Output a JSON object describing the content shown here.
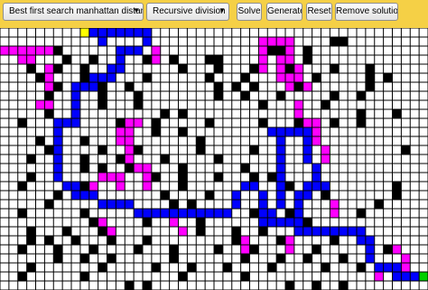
{
  "toolbar": {
    "search_select": {
      "value": "Best first search manhattan distance",
      "arrow_icon": "dropdown-arrow-icon"
    },
    "generator_select": {
      "value": "Recursive division",
      "arrow_icon": "dropdown-arrow-icon"
    },
    "solve_label": "Solve",
    "generate_label": "Generate",
    "reset_label": "Reset",
    "remove_solution_label": "Remove solution"
  },
  "maze": {
    "colors": {
      "wall": "#000000",
      "open": "#ffffff",
      "path": "#0000ff",
      "visited": "#ff00ff",
      "start": "#ffff00",
      "goal": "#00d000"
    },
    "cols": 48,
    "rows": 29,
    "grid": [
      "................................................",
      ".....................................WW.........",
      "..W..WW.......................WW..W.............",
      ".......W..W..W..W..W...WW.........W.............",
      "...W..W..W..W.......W...W...W...W....W...W......",
      "....W....W.W....W......W...W...W...W.....W.W....",
      "......W..W.W..W.........W.W.W....W.......W......",
      ".....W.....W...W........W..W...W.....W..W.......",
      "....W......W...W.............W...W..W...........",
      ".....W..W.........W.W...................W...W...",
      "..W..........W...W.....W.....W...W...W..W.......",
      ".................W..W............W..............",
      "....W....W...W........W........W...W............",
      ".....W.....W...W......W.....W..W..W..........W..",
      "...W.....W...W....W.....W...........W...........",
      "......W..W.W..W.....W......W.......W............",
      "...W.........W...W..W...W...W.W.................",
      "..W......W..........W.......W...W..W........W...",
      "......W...........W....W.......W....W.......W...",
      ".....W.............W.W....................W.....",
      "..W......W......W...W.......W...W.......W.......",
      "..........W.....W.....W...........W.............",
      "...W...W...W..........W...W..W..................",
      "...W.W..W...W...W.........W....W.....W..........",
      "..W...W...W....W...W....W...W......W.......W....",
      "......W..W..W......W.......W...W..W...W.........",
      "...W.......W.....W...W...W....W.....W...W.......",
      "..W......W..........W......W...................W",
      "..............W.W...............W..W..W........."
    ],
    "solution": [
      [
        0,
        9
      ],
      [
        0,
        10
      ],
      [
        0,
        11
      ],
      [
        0,
        12
      ],
      [
        0,
        13
      ],
      [
        0,
        14
      ],
      [
        0,
        15
      ],
      [
        0,
        16
      ],
      [
        1,
        11
      ],
      [
        1,
        16
      ],
      [
        2,
        13
      ],
      [
        2,
        14
      ],
      [
        2,
        15
      ],
      [
        3,
        13
      ],
      [
        4,
        12
      ],
      [
        4,
        13
      ],
      [
        5,
        10
      ],
      [
        5,
        11
      ],
      [
        5,
        12
      ],
      [
        6,
        8
      ],
      [
        6,
        9
      ],
      [
        6,
        10
      ],
      [
        7,
        8
      ],
      [
        8,
        8
      ],
      [
        9,
        8
      ],
      [
        10,
        6
      ],
      [
        10,
        7
      ],
      [
        10,
        8
      ],
      [
        11,
        6
      ],
      [
        12,
        6
      ],
      [
        13,
        6
      ],
      [
        14,
        6
      ],
      [
        15,
        6
      ],
      [
        16,
        6
      ],
      [
        17,
        7
      ],
      [
        17,
        8
      ],
      [
        18,
        8
      ],
      [
        18,
        9
      ],
      [
        18,
        10
      ],
      [
        19,
        11
      ],
      [
        19,
        12
      ],
      [
        19,
        13
      ],
      [
        19,
        14
      ],
      [
        20,
        15
      ],
      [
        20,
        16
      ],
      [
        20,
        17
      ],
      [
        20,
        18
      ],
      [
        20,
        19
      ],
      [
        20,
        20
      ],
      [
        20,
        21
      ],
      [
        20,
        22
      ],
      [
        20,
        23
      ],
      [
        20,
        24
      ],
      [
        20,
        25
      ],
      [
        19,
        26
      ],
      [
        18,
        26
      ],
      [
        17,
        27
      ],
      [
        17,
        28
      ],
      [
        18,
        29
      ],
      [
        19,
        29
      ],
      [
        20,
        29
      ],
      [
        21,
        29
      ],
      [
        21,
        30
      ],
      [
        21,
        31
      ],
      [
        21,
        32
      ],
      [
        20,
        30
      ],
      [
        19,
        31
      ],
      [
        18,
        31
      ],
      [
        17,
        31
      ],
      [
        16,
        31
      ],
      [
        15,
        31
      ],
      [
        14,
        31
      ],
      [
        13,
        31
      ],
      [
        12,
        31
      ],
      [
        11,
        30
      ],
      [
        11,
        31
      ],
      [
        11,
        32
      ],
      [
        11,
        33
      ],
      [
        11,
        34
      ],
      [
        12,
        34
      ],
      [
        13,
        34
      ],
      [
        14,
        34
      ],
      [
        15,
        35
      ],
      [
        16,
        35
      ],
      [
        17,
        34
      ],
      [
        17,
        35
      ],
      [
        17,
        36
      ],
      [
        18,
        33
      ],
      [
        18,
        34
      ],
      [
        19,
        33
      ],
      [
        20,
        33
      ],
      [
        21,
        33
      ],
      [
        22,
        33
      ],
      [
        22,
        34
      ],
      [
        22,
        35
      ],
      [
        22,
        36
      ],
      [
        22,
        37
      ],
      [
        22,
        38
      ],
      [
        22,
        39
      ],
      [
        22,
        40
      ],
      [
        23,
        40
      ],
      [
        23,
        41
      ],
      [
        24,
        41
      ],
      [
        25,
        41
      ],
      [
        26,
        42
      ],
      [
        26,
        43
      ],
      [
        26,
        44
      ],
      [
        27,
        44
      ],
      [
        27,
        45
      ],
      [
        27,
        46
      ]
    ],
    "visited": [
      [
        2,
        0
      ],
      [
        2,
        1
      ],
      [
        2,
        2
      ],
      [
        2,
        3
      ],
      [
        2,
        4
      ],
      [
        2,
        5
      ],
      [
        3,
        2
      ],
      [
        3,
        3
      ],
      [
        4,
        5
      ],
      [
        5,
        5
      ],
      [
        6,
        5
      ],
      [
        2,
        17
      ],
      [
        3,
        17
      ],
      [
        1,
        29
      ],
      [
        2,
        29
      ],
      [
        3,
        29
      ],
      [
        4,
        29
      ],
      [
        1,
        30
      ],
      [
        3,
        32
      ],
      [
        4,
        33
      ],
      [
        5,
        33
      ],
      [
        6,
        34
      ],
      [
        5,
        32
      ],
      [
        6,
        32
      ],
      [
        8,
        4
      ],
      [
        8,
        5
      ],
      [
        10,
        14
      ],
      [
        10,
        15
      ],
      [
        11,
        13
      ],
      [
        11,
        14
      ],
      [
        12,
        13
      ],
      [
        12,
        14
      ],
      [
        13,
        14
      ],
      [
        14,
        14
      ],
      [
        15,
        15
      ],
      [
        15,
        16
      ],
      [
        16,
        16
      ],
      [
        17,
        16
      ],
      [
        16,
        11
      ],
      [
        16,
        12
      ],
      [
        16,
        13
      ],
      [
        17,
        13
      ],
      [
        17,
        10
      ],
      [
        18,
        10
      ],
      [
        1,
        31
      ],
      [
        1,
        32
      ],
      [
        2,
        32
      ],
      [
        3,
        31
      ],
      [
        4,
        31
      ],
      [
        5,
        31
      ],
      [
        8,
        33
      ],
      [
        9,
        33
      ],
      [
        10,
        34
      ],
      [
        10,
        35
      ],
      [
        11,
        35
      ],
      [
        12,
        35
      ],
      [
        13,
        36
      ],
      [
        14,
        36
      ],
      [
        21,
        11
      ],
      [
        22,
        12
      ],
      [
        21,
        19
      ],
      [
        22,
        20
      ],
      [
        23,
        27
      ],
      [
        24,
        27
      ],
      [
        19,
        37
      ],
      [
        20,
        37
      ],
      [
        24,
        44
      ],
      [
        25,
        45
      ],
      [
        26,
        45
      ],
      [
        27,
        42
      ],
      [
        23,
        32
      ],
      [
        24,
        32
      ]
    ],
    "start": [
      0,
      9
    ],
    "goal": [
      27,
      47
    ]
  }
}
